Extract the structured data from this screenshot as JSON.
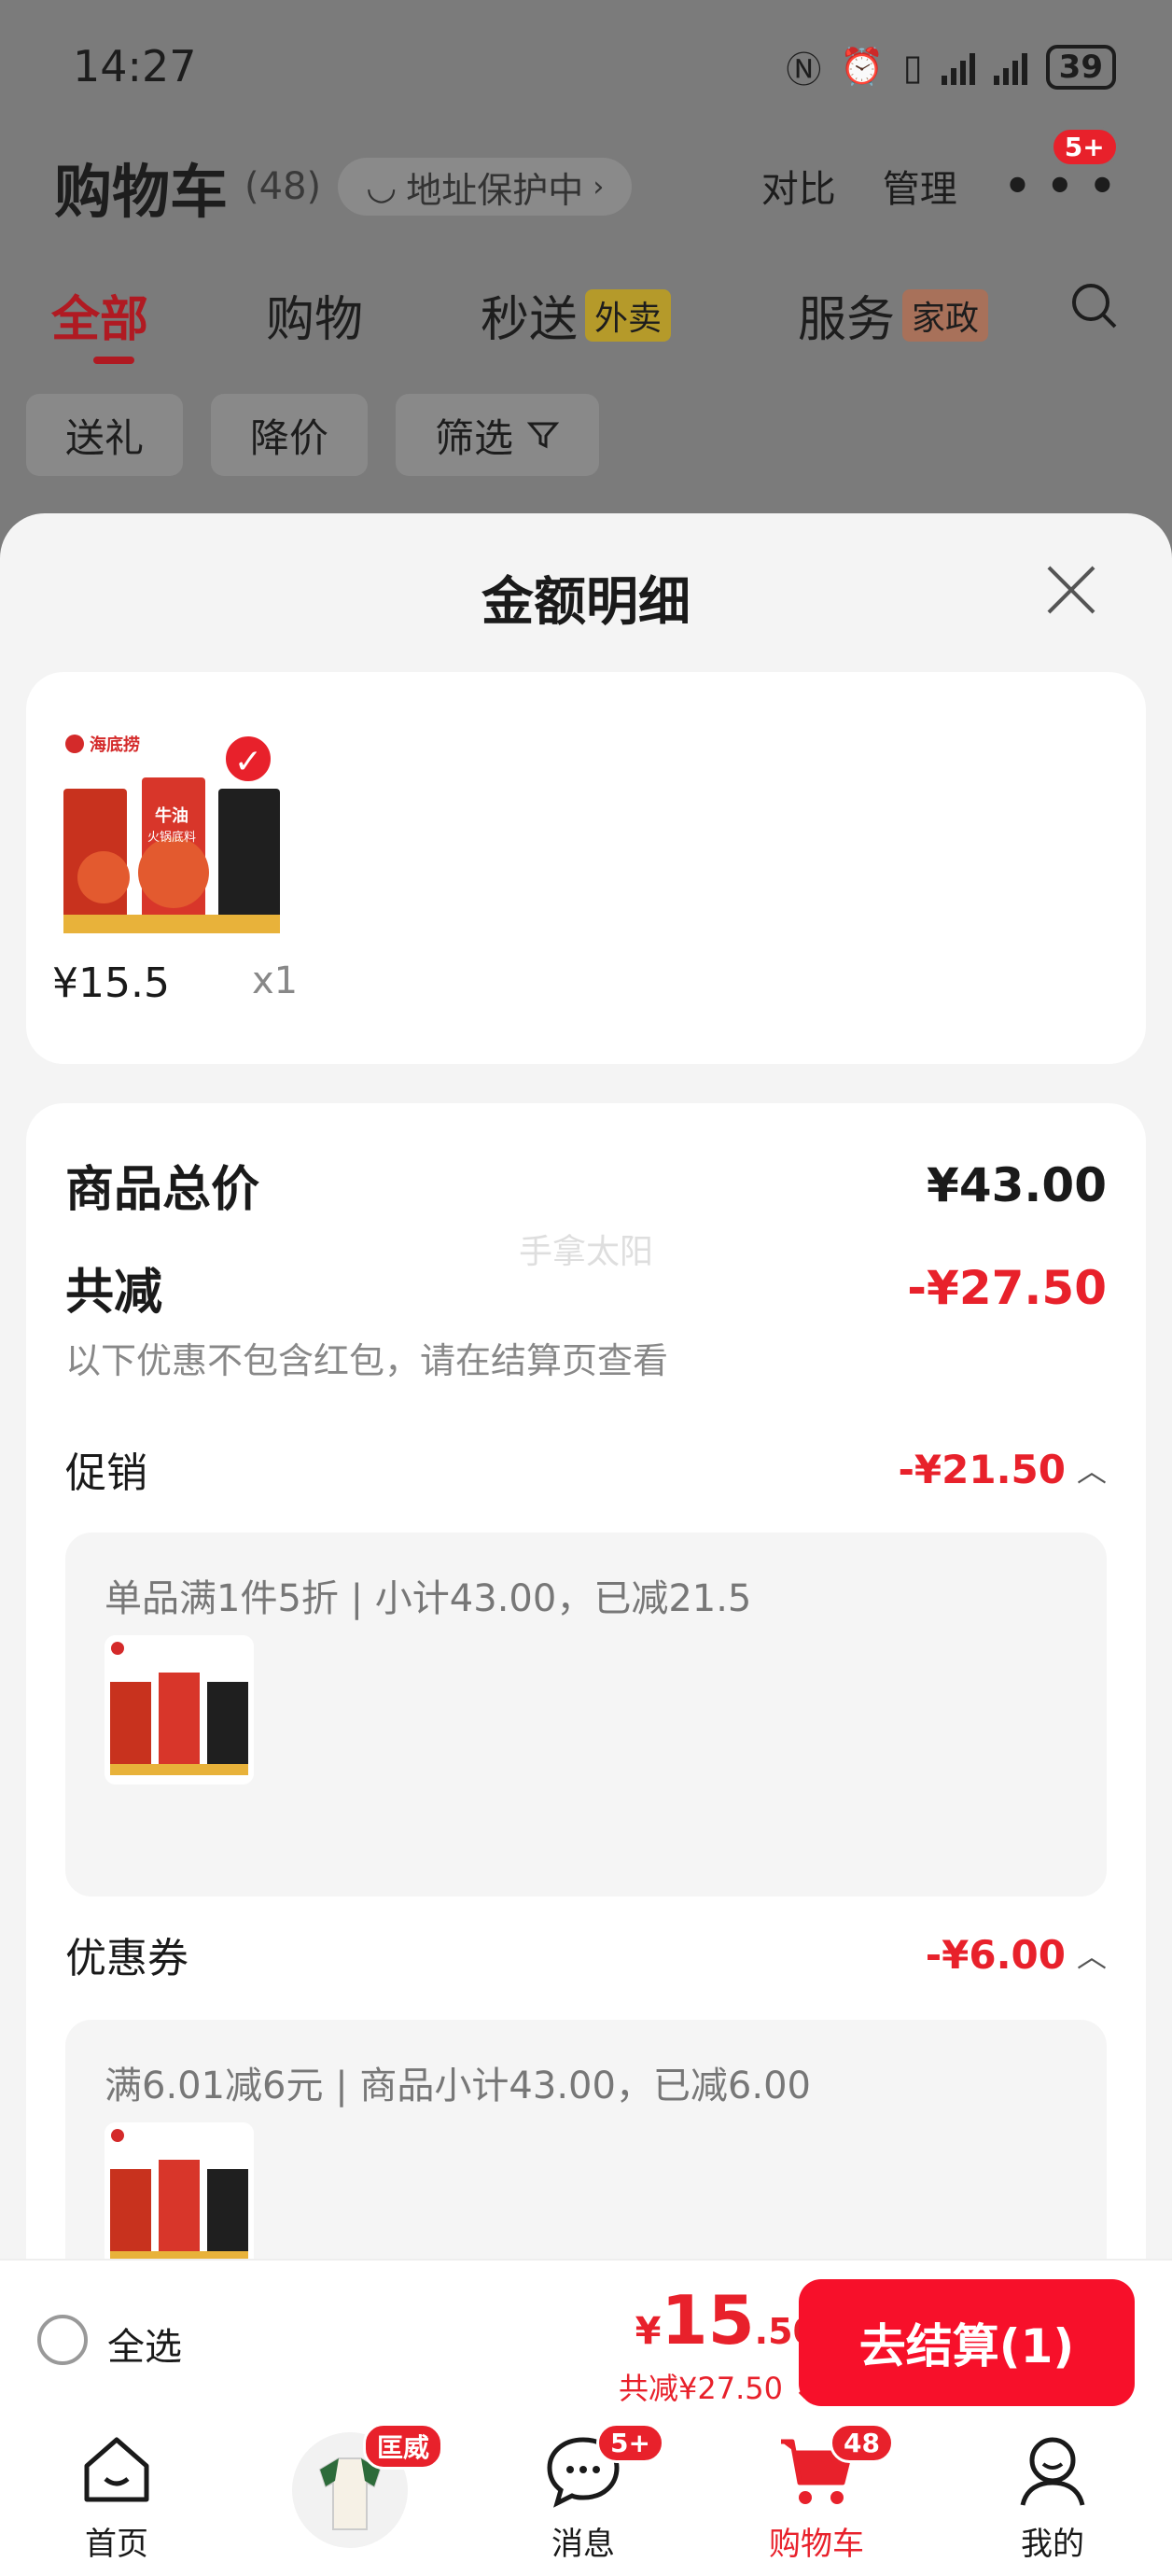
{
  "status": {
    "time": "14:27",
    "battery": "39"
  },
  "header": {
    "title": "购物车",
    "count": "(48)",
    "address": "地址保护中",
    "compare": "对比",
    "manage": "管理",
    "more_badge": "5+"
  },
  "tabs": {
    "all": "全部",
    "shopping": "购物",
    "flash": "秒送",
    "flash_tag": "外卖",
    "service": "服务",
    "service_tag": "家政"
  },
  "filters": {
    "gift": "送礼",
    "price_drop": "降价",
    "filter": "筛选"
  },
  "sheet": {
    "title": "金额明细",
    "product": {
      "price": "¥15.5",
      "qty": "x1",
      "brand": "海底捞",
      "name_line1": "牛油",
      "name_line2": "火锅底料"
    },
    "watermark": "手拿太阳",
    "goods_total_label": "商品总价",
    "goods_total_value": "¥43.00",
    "discount_label": "共减",
    "discount_value": "-¥27.50",
    "discount_note": "以下优惠不包含红包，请在结算页查看",
    "promo_label": "促销",
    "promo_value": "-¥21.50",
    "promo_detail": "单品满1件5折 | 小计43.00，已减21.5",
    "coupon_label": "优惠券",
    "coupon_value": "-¥6.00",
    "coupon_detail": "满6.01减6元 | 商品小计43.00，已减6.00"
  },
  "checkout": {
    "select_all": "全选",
    "price_symbol": "¥",
    "price_int": "15",
    "price_dec": ".50",
    "saved": "共减¥27.50",
    "button": "去结算(1)"
  },
  "nav": {
    "home": "首页",
    "ad_badge": "匡威",
    "messages": "消息",
    "messages_badge": "5+",
    "cart": "购物车",
    "cart_badge": "48",
    "mine": "我的"
  },
  "colors": {
    "accent": "#e8212b",
    "checkout_button": "#f7102a",
    "overlay": "#7b7b7b"
  }
}
